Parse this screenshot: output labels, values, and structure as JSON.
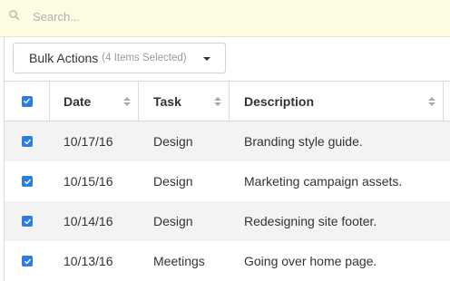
{
  "search": {
    "placeholder": "Search...",
    "value": ""
  },
  "bulk_actions": {
    "label": "Bulk Actions",
    "selected_note": "(4 Items Selected)"
  },
  "table": {
    "columns": [
      "Date",
      "Task",
      "Description"
    ],
    "rows": [
      {
        "checked": true,
        "date": "10/17/16",
        "task": "Design",
        "description": "Branding style guide."
      },
      {
        "checked": true,
        "date": "10/15/16",
        "task": "Design",
        "description": "Marketing campaign assets."
      },
      {
        "checked": true,
        "date": "10/14/16",
        "task": "Design",
        "description": "Redesigning site footer."
      },
      {
        "checked": true,
        "date": "10/13/16",
        "task": "Meetings",
        "description": "Going over home page."
      }
    ]
  },
  "colors": {
    "accent": "#2b7de1",
    "search_bg": "#fdfbe2",
    "stripe": "#f3f3f3"
  },
  "icons": {
    "search": "search-icon",
    "sort": "sort-icon",
    "caret": "caret-down-icon",
    "check": "check-icon"
  }
}
